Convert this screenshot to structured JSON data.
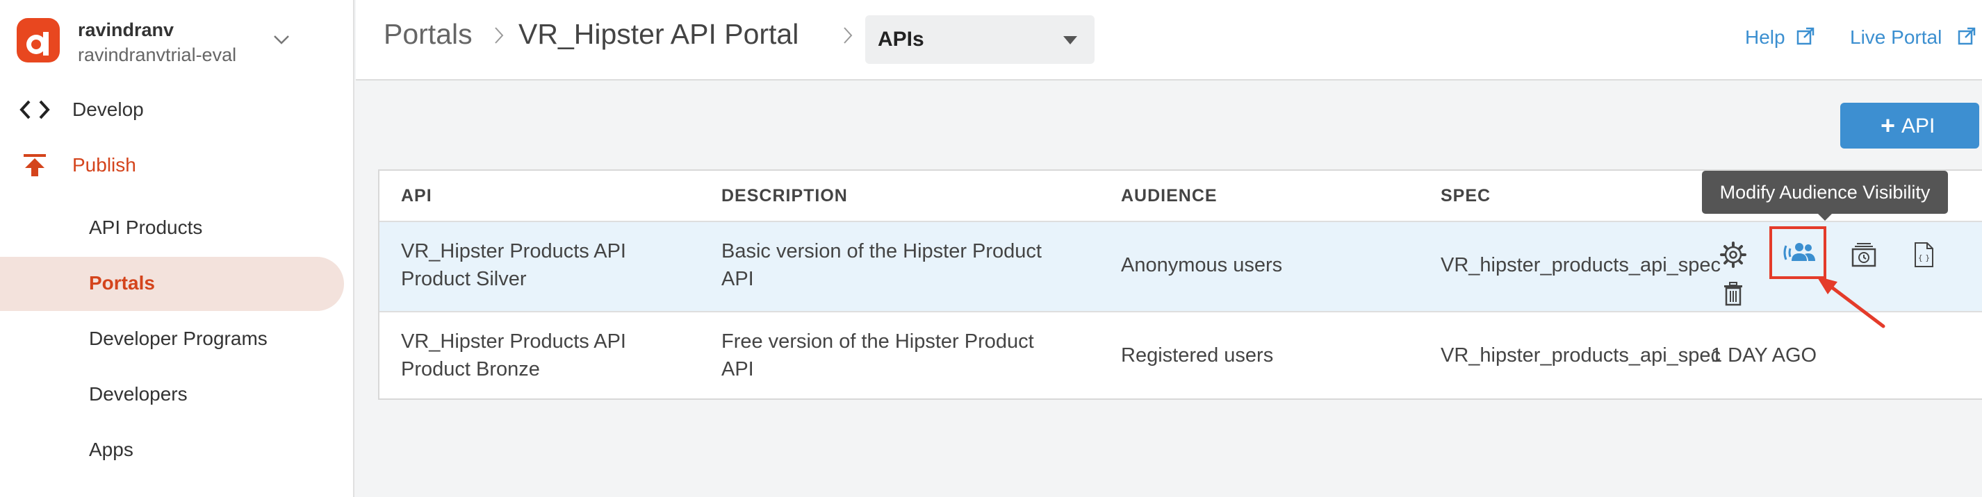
{
  "sidebar": {
    "org_name": "ravindranv",
    "org_sub": "ravindranvtrial-eval",
    "develop_label": "Develop",
    "publish_label": "Publish",
    "items": [
      {
        "label": "API Products"
      },
      {
        "label": "Portals"
      },
      {
        "label": "Developer Programs"
      },
      {
        "label": "Developers"
      },
      {
        "label": "Apps"
      }
    ]
  },
  "header": {
    "crumb_portals": "Portals",
    "crumb_portal": "VR_Hipster API Portal",
    "selected_view": "APIs",
    "help_label": "Help",
    "live_portal_label": "Live Portal"
  },
  "toolbar": {
    "add_label": "API"
  },
  "table": {
    "headers": [
      "API",
      "DESCRIPTION",
      "AUDIENCE",
      "SPEC"
    ],
    "rows": [
      {
        "api_line1": "VR_Hipster Products API",
        "api_line2": "Product Silver",
        "desc_line1": "Basic version of the Hipster Product",
        "desc_line2": "API",
        "audience": "Anonymous users",
        "spec": "VR_hipster_products_api_spec"
      },
      {
        "api_line1": "VR_Hipster Products API",
        "api_line2": "Product Bronze",
        "desc_line1": "Free version of the Hipster Product",
        "desc_line2": "API",
        "audience": "Registered users",
        "spec": "VR_hipster_products_api_spec",
        "updated": "1 DAY AGO"
      }
    ]
  },
  "tooltip": "Modify Audience Visibility",
  "colors": {
    "brand": "#d4441c",
    "link": "#3b8fd0",
    "button": "#3d8fd1",
    "highlight_row": "#e8f3fb",
    "callout": "#e43b2a"
  }
}
